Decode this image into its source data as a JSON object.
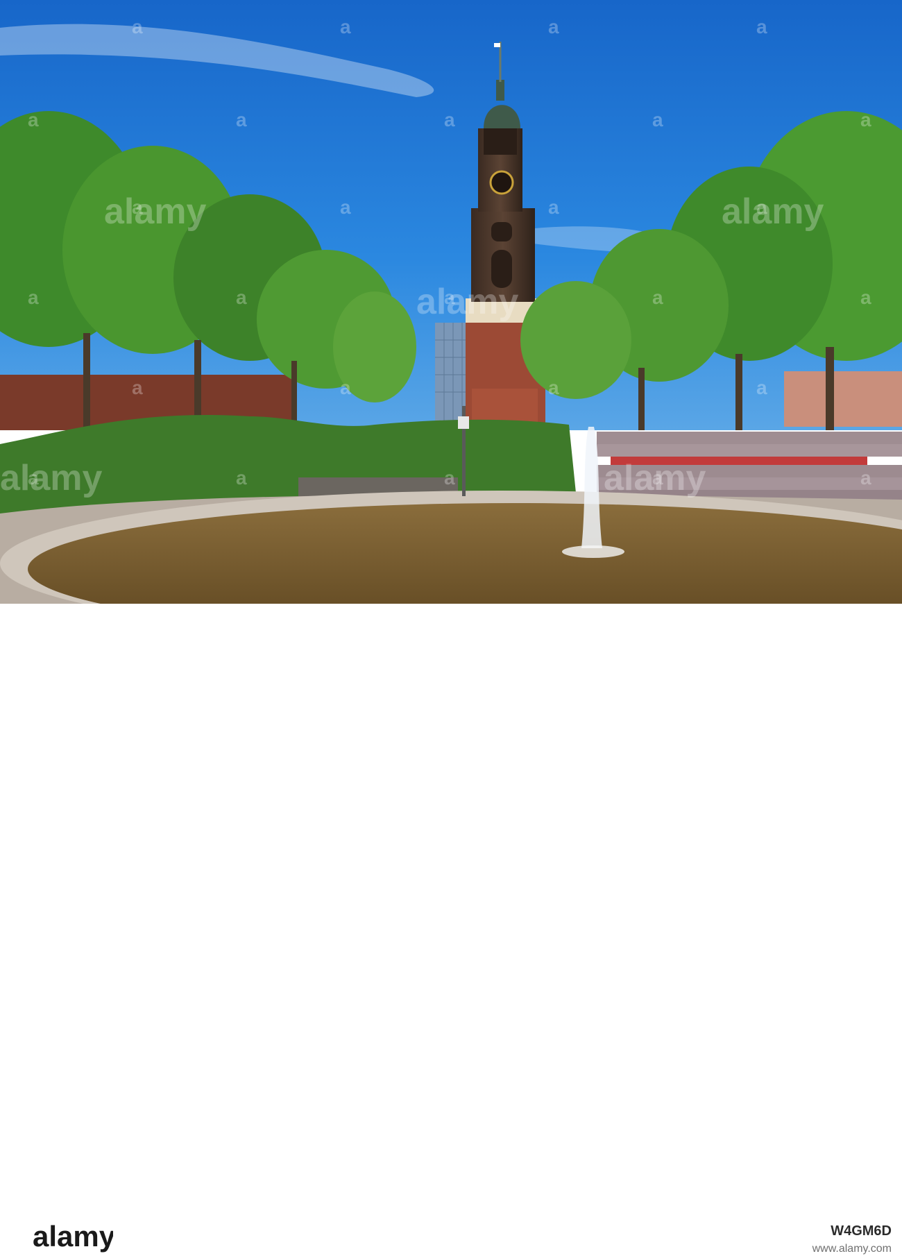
{
  "photo": {
    "subject": "church-tower-with-fountain",
    "colors": {
      "sky": "#1f78d6",
      "foliage": "#3f8a2c",
      "tower": "#4a3529",
      "brick": "#9c4a35",
      "water": "#7a5b2e"
    }
  },
  "watermark": {
    "text": "a",
    "logo": "alamy",
    "stock_label": "alamy"
  },
  "footer": {
    "logo_text": "alamy",
    "image_id": "W4GM6D",
    "site": "www.alamy.com"
  }
}
